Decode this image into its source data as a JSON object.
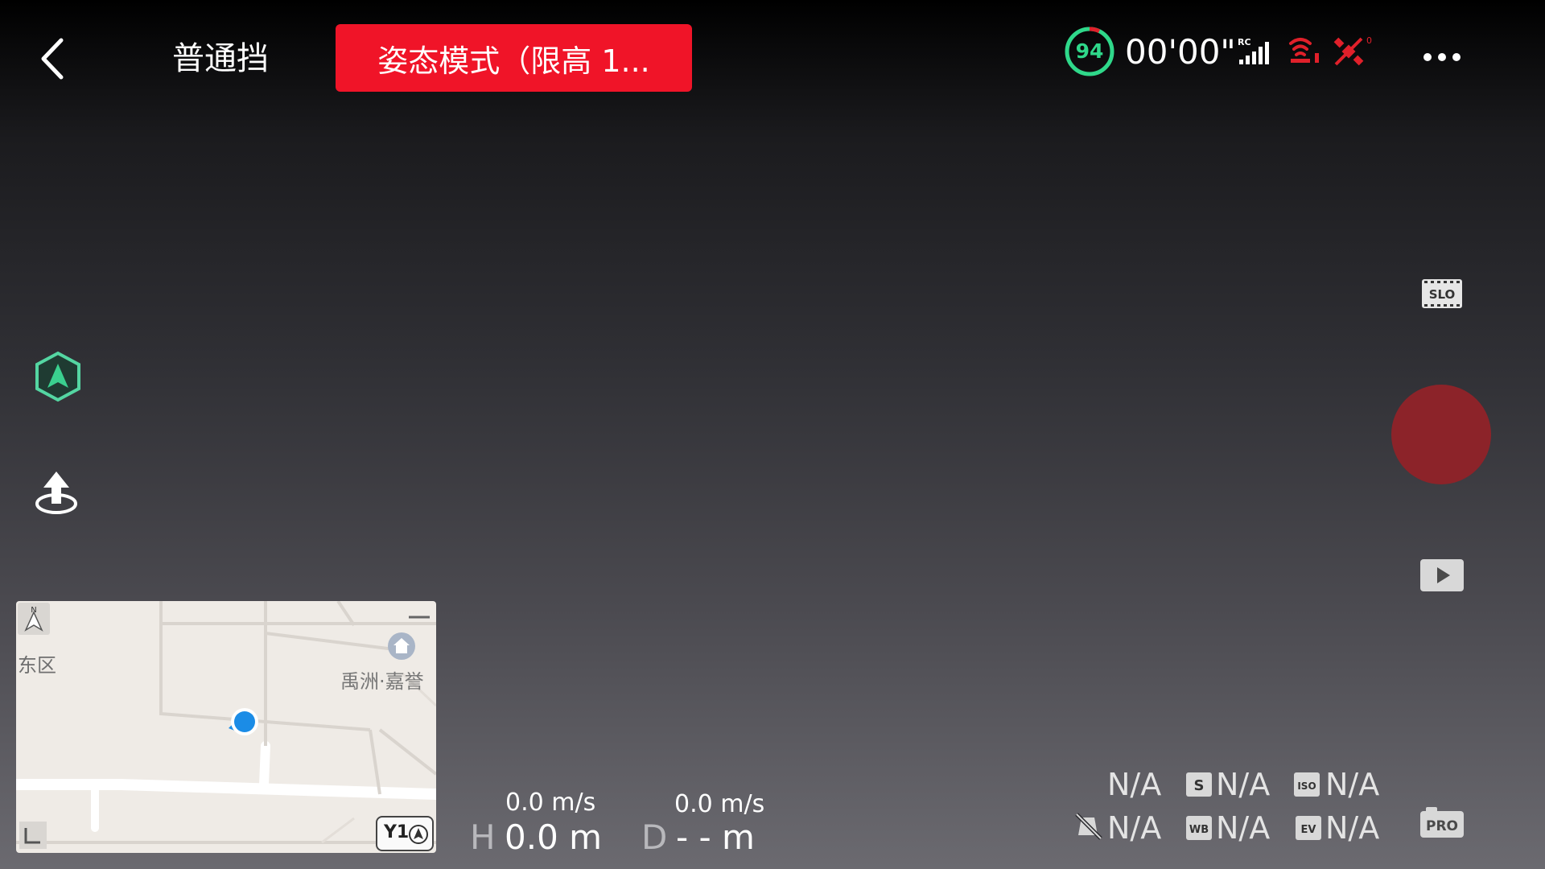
{
  "top_bar": {
    "flight_mode": "普通挡",
    "alert_banner": "姿态模式（限高 1...",
    "battery_percent": "94",
    "flight_time": "00'00\"",
    "rc_label": "RC",
    "gps_count": "0"
  },
  "colors": {
    "alert_red": "#f01428",
    "battery_green": "#2fd88a",
    "shutter_red": "#8c2329",
    "warning_red": "#e0202a"
  },
  "right_controls": {
    "slo_label": "SLO",
    "pro_label": "PRO"
  },
  "minimap": {
    "label_east": "东区",
    "label_poi": "禹洲·嘉誉",
    "scale_label": "Y1"
  },
  "telemetry": {
    "horizontal_speed": "0.0 m/s",
    "vertical_speed": "0.0 m/s",
    "height_label": "H",
    "height_value": "0.0 m",
    "distance_label": "D",
    "distance_value": "- - m"
  },
  "camera_params": {
    "shutter_value": "N/A",
    "s_label": "S",
    "s_value": "N/A",
    "iso_label": "ISO",
    "iso_value": "N/A",
    "af_value": "N/A",
    "wb_label": "WB",
    "wb_value": "N/A",
    "ev_label": "EV",
    "ev_value": "N/A"
  },
  "icons": {
    "back": "chevron-left-icon",
    "more": "more-dots-icon",
    "smart_track": "hexagon-arrow-icon",
    "takeoff": "takeoff-icon",
    "playback": "play-icon"
  }
}
